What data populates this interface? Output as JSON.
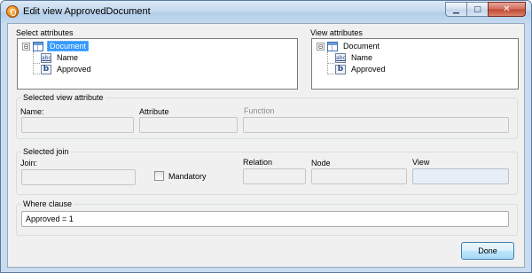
{
  "window": {
    "title": "Edit view ApprovedDocument",
    "minimize_glyph": "▁",
    "maximize_glyph": "□",
    "close_glyph": "✕"
  },
  "select_attributes": {
    "label": "Select attributes",
    "tree": {
      "expander": "⊟",
      "root": "Document",
      "children": [
        "Name",
        "Approved"
      ],
      "child_icons": [
        "abc",
        "b"
      ]
    }
  },
  "view_attributes": {
    "label": "View attributes",
    "tree": {
      "expander": "⊟",
      "root": "Document",
      "children": [
        "Name",
        "Approved"
      ],
      "child_icons": [
        "abc",
        "b"
      ]
    }
  },
  "selected_view_attribute": {
    "title": "Selected view attribute",
    "name_label": "Name:",
    "attribute_label": "Attribute",
    "function_label": "Function"
  },
  "selected_join": {
    "title": "Selected join",
    "join_label": "Join:",
    "mandatory_label": "Mandatory",
    "relation_label": "Relation",
    "node_label": "Node",
    "view_label": "View"
  },
  "where_clause": {
    "title": "Where clause",
    "value": "Approved = 1"
  },
  "buttons": {
    "done": "Done"
  }
}
